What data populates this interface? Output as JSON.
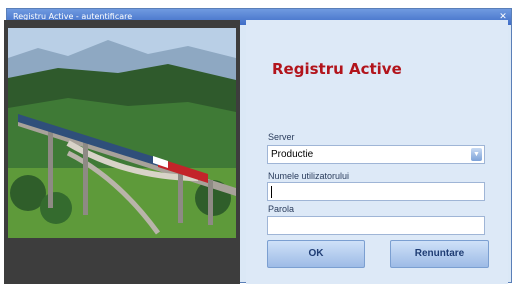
{
  "window": {
    "title": "Registru Active - autentificare"
  },
  "app": {
    "title": "Registru Active"
  },
  "form": {
    "server_label": "Server",
    "server_value": "Productie",
    "username_label": "Numele utilizatorului",
    "username_value": "",
    "password_label": "Parola",
    "password_value": ""
  },
  "buttons": {
    "ok": "OK",
    "cancel": "Renuntare"
  },
  "icons": {
    "close": "close-icon",
    "dropdown": "chevron-down-icon"
  },
  "colors": {
    "title_red": "#b2141c",
    "titlebar_blue": "#3f6dc7"
  }
}
